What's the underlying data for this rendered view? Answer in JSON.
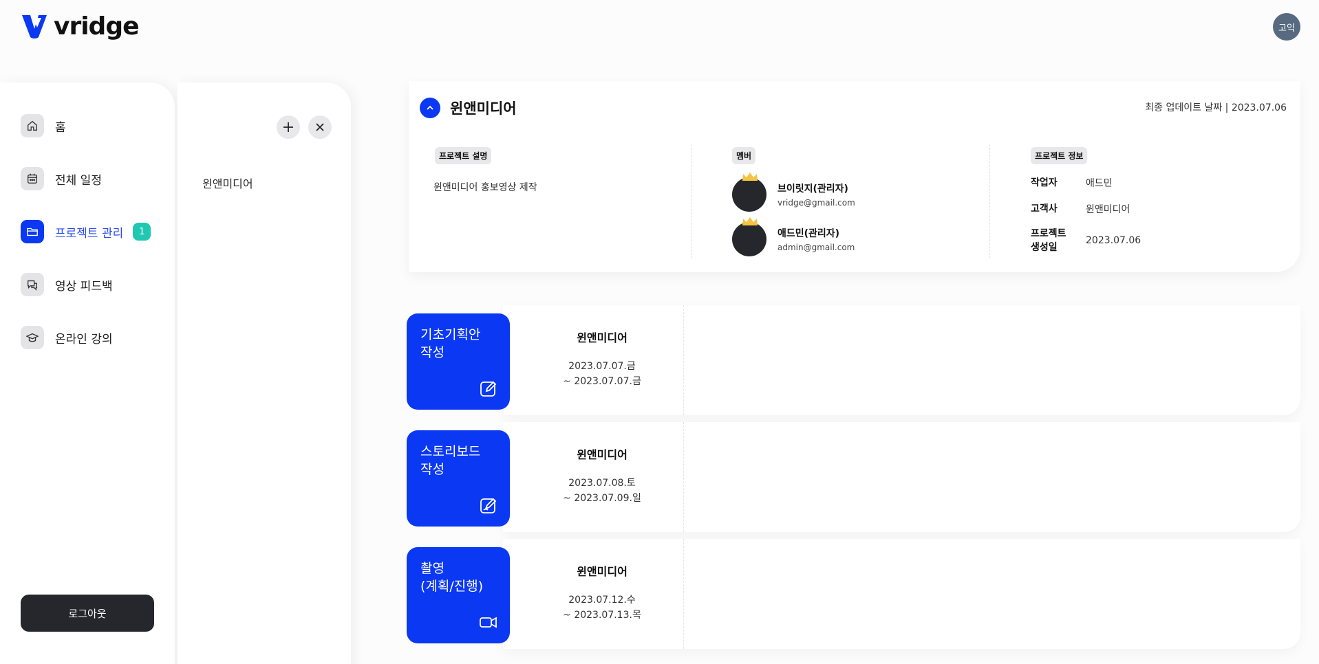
{
  "app": {
    "logo_text": "vridge",
    "avatar_label": "고익"
  },
  "sidebar": {
    "items": [
      {
        "label": "홈",
        "icon": "home-icon"
      },
      {
        "label": "전체 일정",
        "icon": "calendar-icon"
      },
      {
        "label": "프로젝트 관리",
        "icon": "folder-icon",
        "badge": "1",
        "active": true
      },
      {
        "label": "영상 피드백",
        "icon": "chat-icon"
      },
      {
        "label": "온라인 강의",
        "icon": "graduation-cap-icon"
      }
    ],
    "logout_label": "로그아웃"
  },
  "project_panel": {
    "items": [
      "윈앤미디어"
    ]
  },
  "project": {
    "title": "윈앤미디어",
    "last_update": "최종 업데이트 날짜 | 2023.07.06",
    "description_label": "프로젝트 설명",
    "description": "윈앤미디어 홍보영상 제작",
    "members_label": "멤버",
    "members": [
      {
        "name": "브이릿지(관리자)",
        "email": "vridge@gmail.com"
      },
      {
        "name": "애드민(관리자)",
        "email": "admin@gmail.com"
      }
    ],
    "info_label": "프로젝트 정보",
    "info": [
      {
        "key": "작업자",
        "value": "애드민"
      },
      {
        "key": "고객사",
        "value": "윈앤미디어"
      },
      {
        "key": "프로젝트\n생성일",
        "value": "2023.07.06"
      }
    ]
  },
  "tasks": [
    {
      "label": "기초기획안\n작성",
      "icon": "edit-icon",
      "project": "윈앤미디어",
      "start": "2023.07.07.금",
      "end": "~ 2023.07.07.금"
    },
    {
      "label": "스토리보드\n작성",
      "icon": "draw-icon",
      "project": "윈앤미디어",
      "start": "2023.07.08.토",
      "end": "~ 2023.07.09.일"
    },
    {
      "label": "촬영\n(계획/진행)",
      "icon": "video-camera-icon",
      "project": "윈앤미디어",
      "start": "2023.07.12.수",
      "end": "~ 2023.07.13.목"
    }
  ],
  "colors": {
    "accent": "#0b38f2",
    "badge": "#20c8b2",
    "dark": "#25272d"
  }
}
